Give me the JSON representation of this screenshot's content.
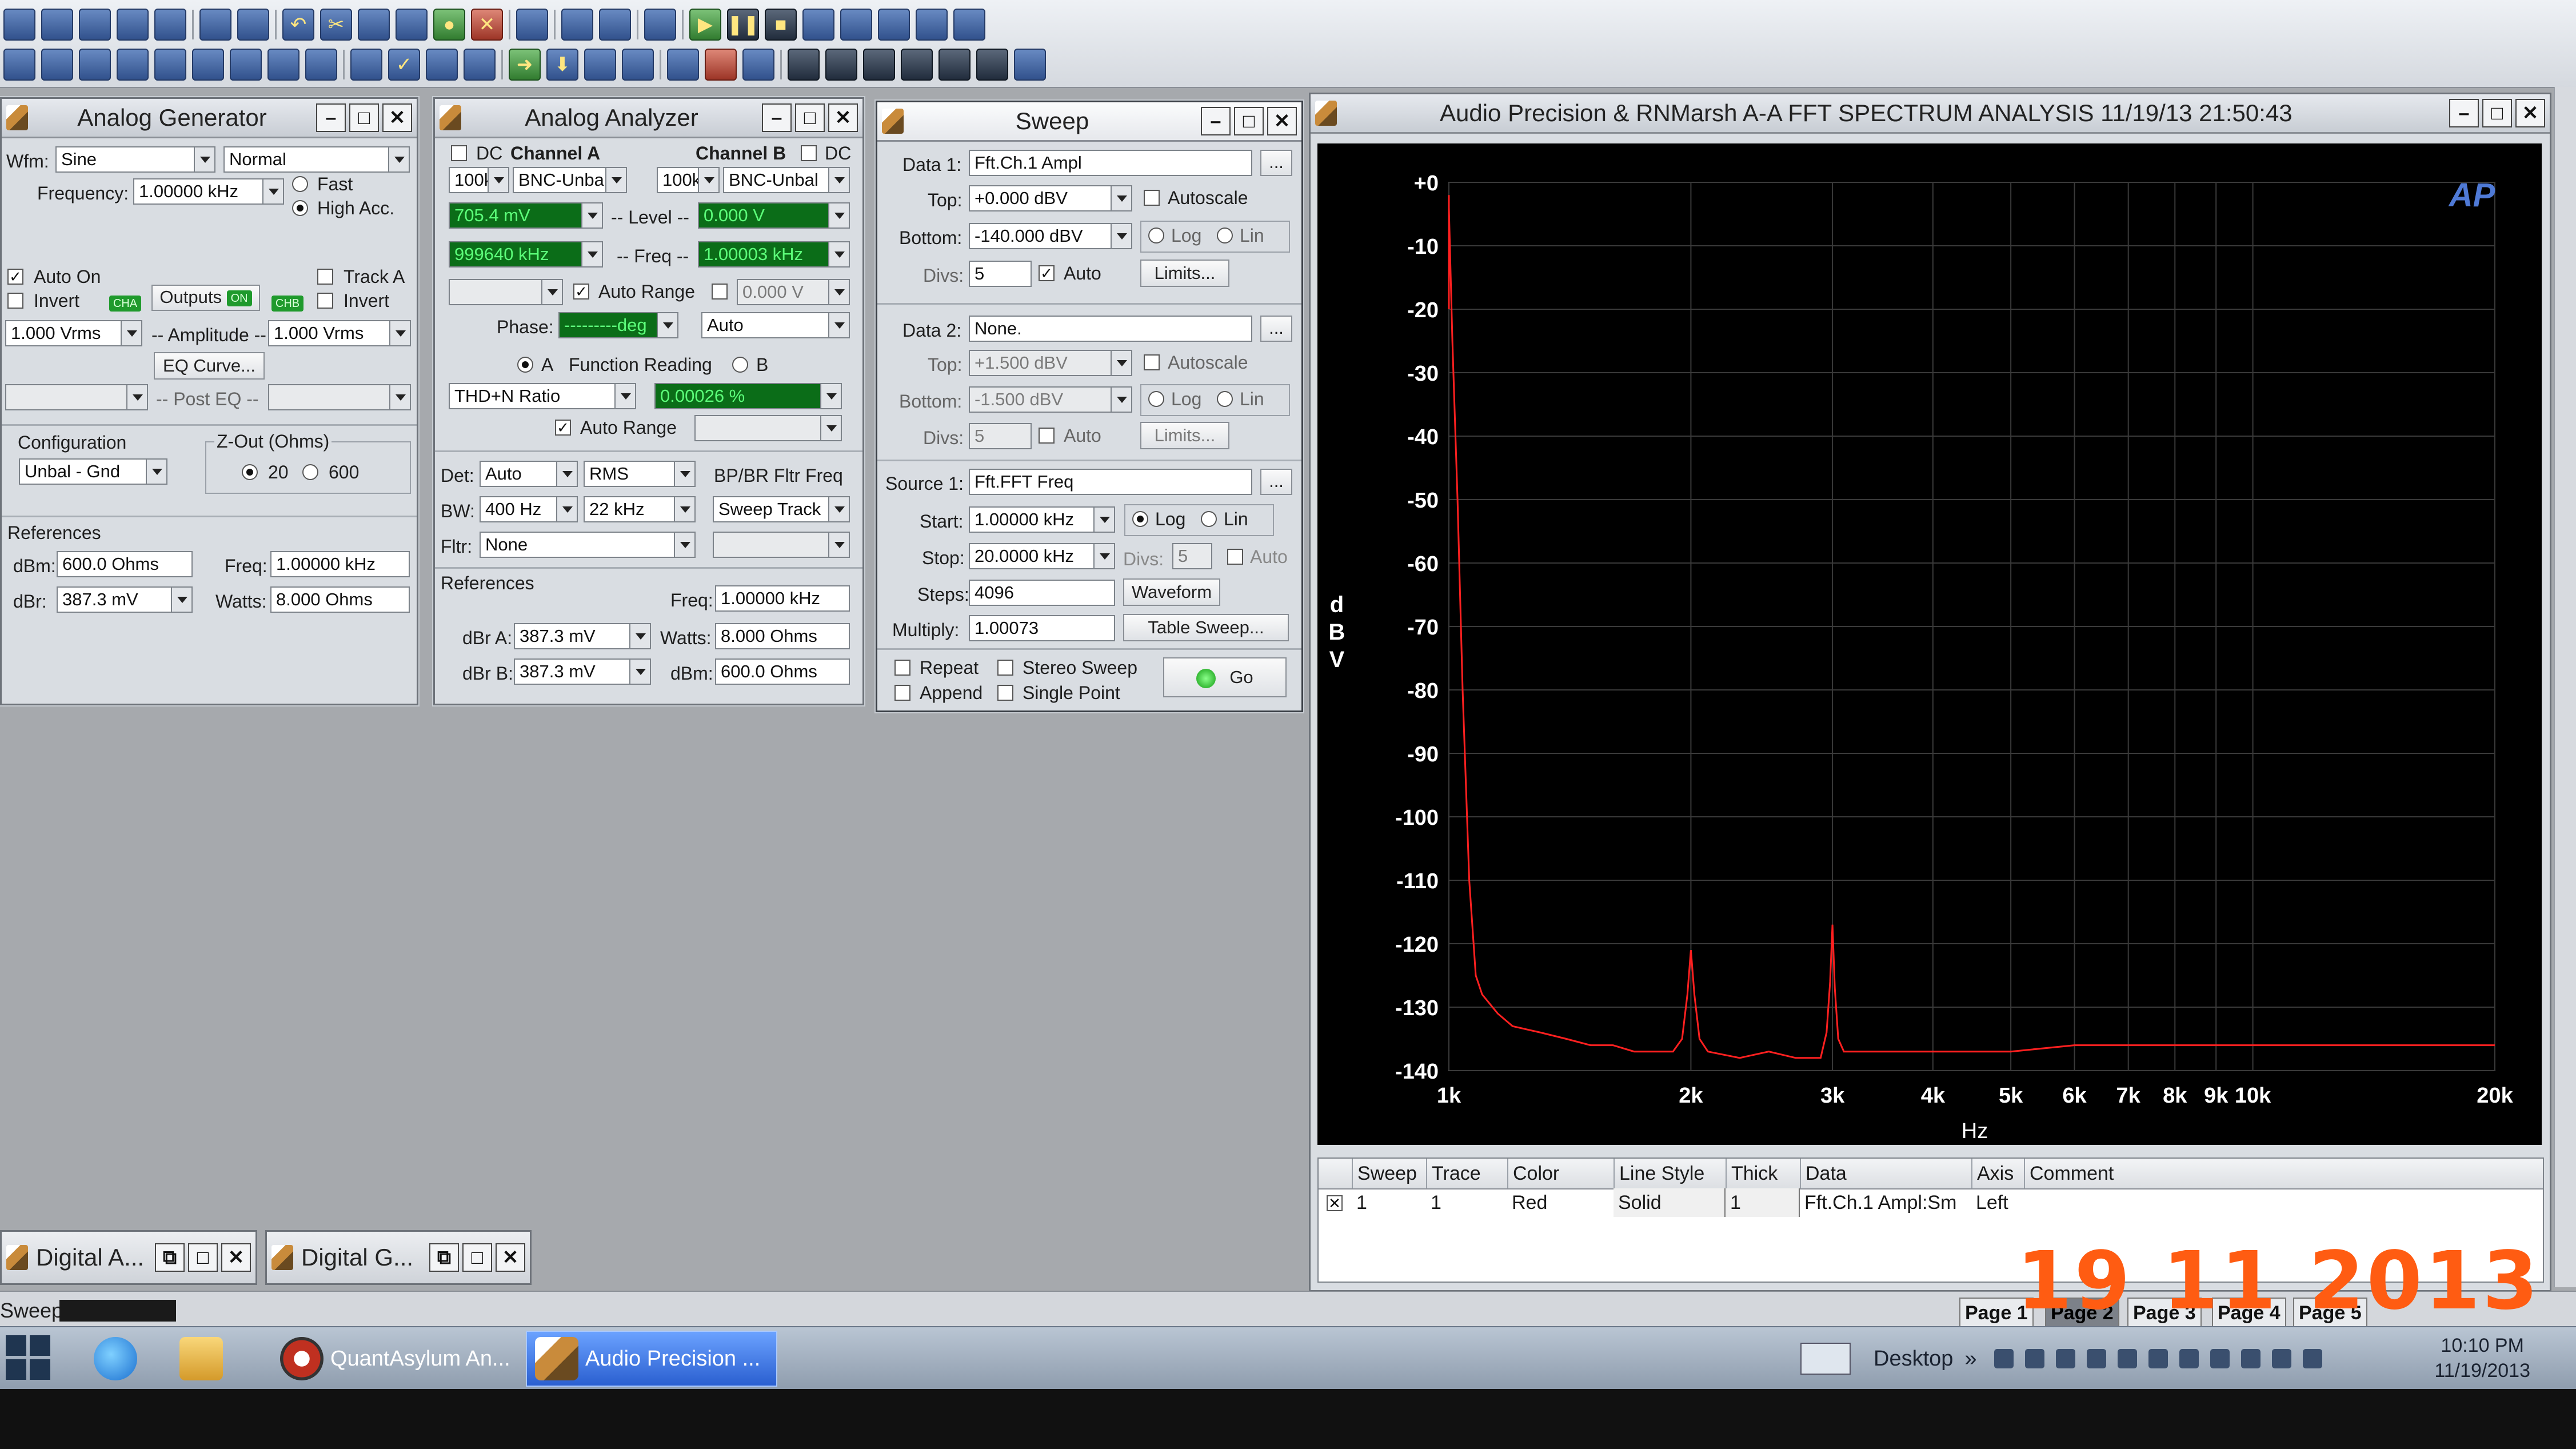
{
  "gen": {
    "title": "Analog Generator",
    "wfm_label": "Wfm:",
    "wfm": "Sine",
    "mode": "Normal",
    "freq_label": "Frequency:",
    "freq": "1.00000 kHz",
    "fast": "Fast",
    "high_acc": "High Acc.",
    "auto_on": "Auto On",
    "track_a": "Track A",
    "invert": "Invert",
    "outputs": "Outputs",
    "on": "ON",
    "cha": "CHA",
    "chb": "CHB",
    "amp_a": "1.000  Vrms",
    "amp_label": "-- Amplitude --",
    "amp_b": "1.000  Vrms",
    "eq_curve": "EQ Curve...",
    "post_eq": "-- Post EQ --",
    "config_label": "Configuration",
    "config": "Unbal - Gnd",
    "zout_label": "Z-Out (Ohms)",
    "z20": "20",
    "z600": "600",
    "refs": "References",
    "dbm_label": "dBm:",
    "dbm": "600.0  Ohms",
    "freq_ref_label": "Freq:",
    "freq_ref": "1.00000 kHz",
    "dbr_label": "dBr:",
    "dbr": "387.3  mV",
    "watts_label": "Watts:",
    "watts": "8.000  Ohms"
  },
  "ana": {
    "title": "Analog Analyzer",
    "dc": "DC",
    "cha": "Channel A",
    "chb": "Channel B",
    "range_a": "100k",
    "input_a": "BNC-Unbal",
    "range_b": "100k",
    "input_b": "BNC-Unbal",
    "level_a": "705.4  mV",
    "level_label": "-- Level --",
    "level_b": "0.000  V",
    "freq_a": "999640 kHz",
    "freq_label": "-- Freq --",
    "freq_b": "1.00003 kHz",
    "auto_range": "Auto Range",
    "v0": "0.000   V",
    "phase_label": "Phase:",
    "phase": "---------deg",
    "phase_mode": "Auto",
    "a": "A",
    "func_reading": "Function Reading",
    "b": "B",
    "func": "THD+N Ratio",
    "func_val": "0.00026  %",
    "det_label": "Det:",
    "det": "Auto",
    "rms": "RMS",
    "bpbr": "BP/BR Fltr Freq",
    "bw_label": "BW:",
    "bw_lo": "400 Hz",
    "bw_hi": "22 kHz",
    "sweep_track": "Sweep Track",
    "fltr_label": "Fltr:",
    "fltr": "None",
    "refs": "References",
    "freq_ref_label": "Freq:",
    "freq_ref": "1.00000 kHz",
    "dbra_label": "dBr A:",
    "dbra": "387.3  mV",
    "watts_label": "Watts:",
    "watts": "8.000   Ohms",
    "dbrb_label": "dBr B:",
    "dbrb": "387.3  mV",
    "dbm_label": "dBm:",
    "dbm": "600.0   Ohms"
  },
  "sweep": {
    "title": "Sweep",
    "data1_label": "Data 1:",
    "data1": "Fft.Ch.1 Ampl",
    "dots": "...",
    "top_label": "Top:",
    "top1": "+0.000  dBV",
    "autoscale": "Autoscale",
    "bottom_label": "Bottom:",
    "bottom1": "-140.000 dBV",
    "log": "Log",
    "lin": "Lin",
    "divs_label": "Divs:",
    "divs1": "5",
    "auto": "Auto",
    "limits": "Limits...",
    "data2_label": "Data 2:",
    "data2": "None.",
    "top2": "+1.500  dBV",
    "bottom2": "-1.500  dBV",
    "divs2": "5",
    "source_label": "Source 1:",
    "source": "Fft.FFT Freq",
    "start_label": "Start:",
    "start": "1.00000 kHz",
    "stop_label": "Stop:",
    "stop": "20.0000 kHz",
    "divs3": "5",
    "steps_label": "Steps:",
    "steps": "4096",
    "waveform": "Waveform",
    "multiply_label": "Multiply:",
    "multiply": "1.00073",
    "table_sweep": "Table Sweep...",
    "repeat": "Repeat",
    "stereo": "Stereo Sweep",
    "append": "Append",
    "single": "Single Point",
    "go": "Go"
  },
  "fft": {
    "title": "Audio Precision & RNMarsh    A-A FFT SPECTRUM ANALYSIS     11/19/13 21:50:43",
    "logo": "AP",
    "ylabel": "dBV",
    "xlabel": "Hz",
    "legend_headers": [
      "Sweep",
      "Trace",
      "Color",
      "Line Style",
      "Thick",
      "Data",
      "Axis",
      "Comment"
    ],
    "legend_row": [
      "1",
      "1",
      "Red",
      "Solid",
      "1",
      "Fft.Ch.1 Ampl:Sm",
      "Left",
      ""
    ]
  },
  "chart_data": {
    "type": "line",
    "title": "",
    "xlabel": "Hz",
    "ylabel": "dBV",
    "x_scale": "log",
    "xlim": [
      1000,
      20000
    ],
    "ylim": [
      -140,
      0
    ],
    "x_ticks": [
      1000,
      2000,
      3000,
      4000,
      5000,
      6000,
      7000,
      8000,
      9000,
      10000,
      20000
    ],
    "x_tick_labels": [
      "1k",
      "2k",
      "3k",
      "4k",
      "5k",
      "6k",
      "7k",
      "8k",
      "9k",
      "10k",
      "20k"
    ],
    "y_ticks": [
      0,
      -10,
      -20,
      -30,
      -40,
      -50,
      -60,
      -70,
      -80,
      -90,
      -100,
      -110,
      -120,
      -130,
      -140
    ],
    "y_tick_labels": [
      "+0",
      "-10",
      "-20",
      "-30",
      "-40",
      "-50",
      "-60",
      "-70",
      "-80",
      "-90",
      "-100",
      "-110",
      "-120",
      "-130",
      "-140"
    ],
    "grid": true,
    "color": "#ff2020",
    "series": [
      {
        "x": [
          960,
          975,
          990,
          1000,
          1010,
          1025,
          1040,
          1060,
          1080,
          1100,
          1150,
          1200,
          1300,
          1400,
          1500,
          1600,
          1700,
          1800,
          1900,
          1950,
          1980,
          2000,
          2020,
          2050,
          2100,
          2300,
          2500,
          2700,
          2900,
          2950,
          2980,
          3000,
          3020,
          3050,
          3100,
          3500,
          4000,
          5000,
          6000,
          7000,
          8000,
          9000,
          10000,
          12000,
          15000,
          18000,
          20000
        ],
        "y": [
          -2,
          -8,
          -20,
          -4,
          -25,
          -50,
          -80,
          -110,
          -125,
          -128,
          -131,
          -133,
          -134,
          -135,
          -136,
          -136,
          -137,
          -137,
          -137,
          -135,
          -128,
          -121,
          -128,
          -135,
          -137,
          -138,
          -137,
          -138,
          -138,
          -134,
          -126,
          -117,
          -127,
          -135,
          -137,
          -137,
          -137,
          -137,
          -136,
          -136,
          -136,
          -136,
          -136,
          -136,
          -136,
          -136,
          -136
        ]
      }
    ]
  },
  "mini1": {
    "title": "Digital A..."
  },
  "mini2": {
    "title": "Digital G..."
  },
  "status": {
    "text": "Sweep"
  },
  "pages": [
    "Page 1",
    "Page 2",
    "Page 3",
    "Page 4",
    "Page 5"
  ],
  "datestamp": "19  11  2013",
  "taskbar": {
    "app1": "QuantAsylum An...",
    "app2": "Audio Precision ...",
    "desktop": "Desktop",
    "time": "10:10 PM",
    "date": "11/19/2013"
  }
}
